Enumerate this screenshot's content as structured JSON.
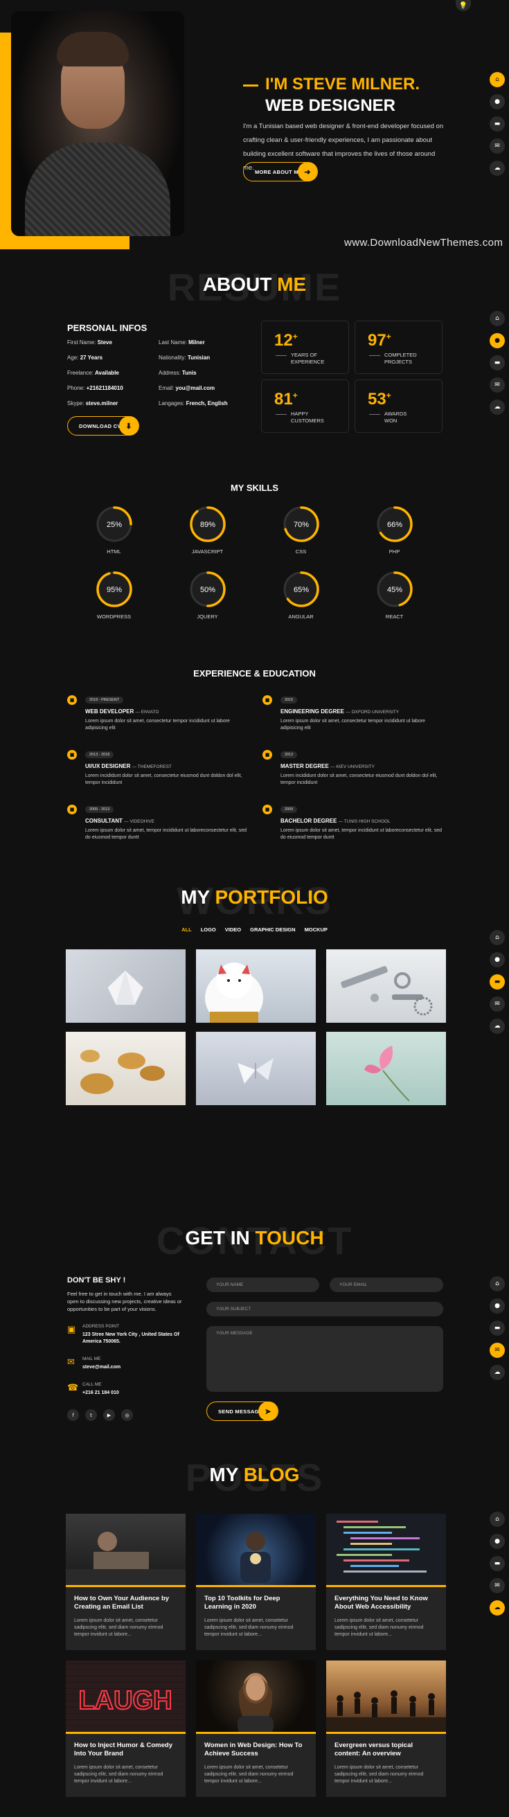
{
  "colors": {
    "accent": "#ffb400",
    "background": "#111111",
    "card": "#252525"
  },
  "watermark": "www.DownloadNewThemes.com",
  "nav": {
    "items": [
      {
        "name": "home",
        "icon": "home-icon",
        "glyph": "⌂"
      },
      {
        "name": "about",
        "icon": "user-icon",
        "glyph": "●"
      },
      {
        "name": "portfolio",
        "icon": "briefcase-icon",
        "glyph": "▬"
      },
      {
        "name": "contact",
        "icon": "envelope-icon",
        "glyph": "✉"
      },
      {
        "name": "blog",
        "icon": "comments-icon",
        "glyph": "☁"
      }
    ]
  },
  "hero": {
    "title": "I'M STEVE MILNER.",
    "subtitle": "WEB DESIGNER",
    "text": "I'm a Tunisian based web designer & front‑end developer focused on crafting clean & user‑friendly experiences, I am passionate about building excellent software that improves the lives of those around me.",
    "button": "MORE ABOUT ME"
  },
  "about": {
    "bg_title": "RESUME",
    "title_a": "ABOUT",
    "title_b": "ME",
    "personal_title": "PERSONAL INFOS",
    "info": [
      {
        "label": "First Name:",
        "value": "Steve"
      },
      {
        "label": "Last Name:",
        "value": "Milner"
      },
      {
        "label": "Age:",
        "value": "27 Years"
      },
      {
        "label": "Nationality:",
        "value": "Tunisian"
      },
      {
        "label": "Freelance:",
        "value": "Available"
      },
      {
        "label": "Address:",
        "value": "Tunis"
      },
      {
        "label": "Phone:",
        "value": "+21621184010"
      },
      {
        "label": "Email:",
        "value": "you@mail.com"
      },
      {
        "label": "Skype:",
        "value": "steve.milner"
      },
      {
        "label": "Langages:",
        "value": "French, English"
      }
    ],
    "cv_button": "DOWNLOAD CV",
    "stats": [
      {
        "value": "12",
        "line1": "YEARS OF",
        "line2": "EXPERIENCE"
      },
      {
        "value": "97",
        "line1": "COMPLETED",
        "line2": "PROJECTS"
      },
      {
        "value": "81",
        "line1": "HAPPY",
        "line2": "CUSTOMERS"
      },
      {
        "value": "53",
        "line1": "AWARDS",
        "line2": "WON"
      }
    ],
    "stat_plus": "+"
  },
  "skills": {
    "title": "MY SKILLS",
    "items": [
      {
        "name": "HTML",
        "percent": 25,
        "label": "25%"
      },
      {
        "name": "JAVASCRIPT",
        "percent": 89,
        "label": "89%"
      },
      {
        "name": "CSS",
        "percent": 70,
        "label": "70%"
      },
      {
        "name": "PHP",
        "percent": 66,
        "label": "66%"
      },
      {
        "name": "WORDPRESS",
        "percent": 95,
        "label": "95%"
      },
      {
        "name": "JQUERY",
        "percent": 50,
        "label": "50%"
      },
      {
        "name": "ANGULAR",
        "percent": 65,
        "label": "65%"
      },
      {
        "name": "REACT",
        "percent": 45,
        "label": "45%"
      }
    ]
  },
  "experience": {
    "title": "EXPERIENCE & EDUCATION",
    "left": [
      {
        "date": "2018 - PRESENT",
        "role": "WEB DEVELOPER",
        "place": "ENVATO",
        "desc": "Lorem ipsum dolor sit amet, consectetur tempor incididunt ut labore adipisicing elit"
      },
      {
        "date": "2013 - 2018",
        "role": "UI/UX DESIGNER",
        "place": "THEMEFOREST",
        "desc": "Lorem incididunt dolor sit amet, consectetur eiusmod dunt doldon dol elit, tempor incididunt"
      },
      {
        "date": "2005 - 2013",
        "role": "CONSULTANT",
        "place": "VIDEOHIVE",
        "desc": "Lorem ipsum dolor sit amet, tempor incididunt ut laboreconsectetur elit, sed do eiusmod tempor duntt"
      }
    ],
    "right": [
      {
        "date": "2015",
        "role": "ENGINEERING DEGREE",
        "place": "OXFORD UNIVERSITY",
        "desc": "Lorem ipsum dolor sit amet, consectetur tempor incididunt ut labore adipisicing elit"
      },
      {
        "date": "2012",
        "role": "MASTER DEGREE",
        "place": "KIEV UNIVERSITY",
        "desc": "Lorem incididunt dolor sit amet, consectetur eiusmod dunt doldon dol elit, tempor incididunt"
      },
      {
        "date": "2009",
        "role": "BACHELOR DEGREE",
        "place": "TUNIS HIGH SCHOOL",
        "desc": "Lorem ipsum dolor sit amet, tempor incididunt ut laboreconsectetur elit, sed do eiusmod tempor duntt"
      }
    ],
    "dash": "—"
  },
  "portfolio": {
    "bg_title": "WORKS",
    "title_a": "MY",
    "title_b": "PORTFOLIO",
    "filters": [
      "ALL",
      "LOGO",
      "VIDEO",
      "GRAPHIC DESIGN",
      "MOCKUP"
    ]
  },
  "contact": {
    "bg_title": "CONTACT",
    "title_a": "GET IN",
    "title_b": "TOUCH",
    "heading": "DON'T BE SHY !",
    "text": "Feel free to get in touch with me. I am always open to discussing new projects, creative ideas or opportunities to be part of your visions.",
    "address_label": "ADDRESS POINT",
    "address": "123 Stree New York City , United States Of America 750065.",
    "mail_label": "MAIL ME",
    "mail": "steve@mail.com",
    "call_label": "CALL ME",
    "phone": "+216 21 184 010",
    "socials": [
      "f",
      "t",
      "▶",
      "◎"
    ],
    "placeholders": {
      "name": "YOUR NAME",
      "email": "YOUR EMAIL",
      "subject": "YOUR SUBJECT",
      "message": "YOUR MESSAGE"
    },
    "send": "SEND MESSAGE"
  },
  "blog": {
    "bg_title": "POSTS",
    "title_a": "MY",
    "title_b": "BLOG",
    "excerpt": "Lorem ipsum dolor sit amet, consetetur sadipscing elitr, sed diam nonumy eirmod tempor invidunt ut labore...",
    "posts": [
      {
        "title": "How to Own Your Audience by Creating an Email List"
      },
      {
        "title": "Top 10 Toolkits for Deep Learning in 2020"
      },
      {
        "title": "Everything You Need to Know About Web Accessibility"
      },
      {
        "title": "How to Inject Humor & Comedy Into Your Brand"
      },
      {
        "title": "Women in Web Design: How To Achieve Success"
      },
      {
        "title": "Evergreen versus topical content: An overview"
      }
    ],
    "laugh_sign": "LAUGH"
  }
}
